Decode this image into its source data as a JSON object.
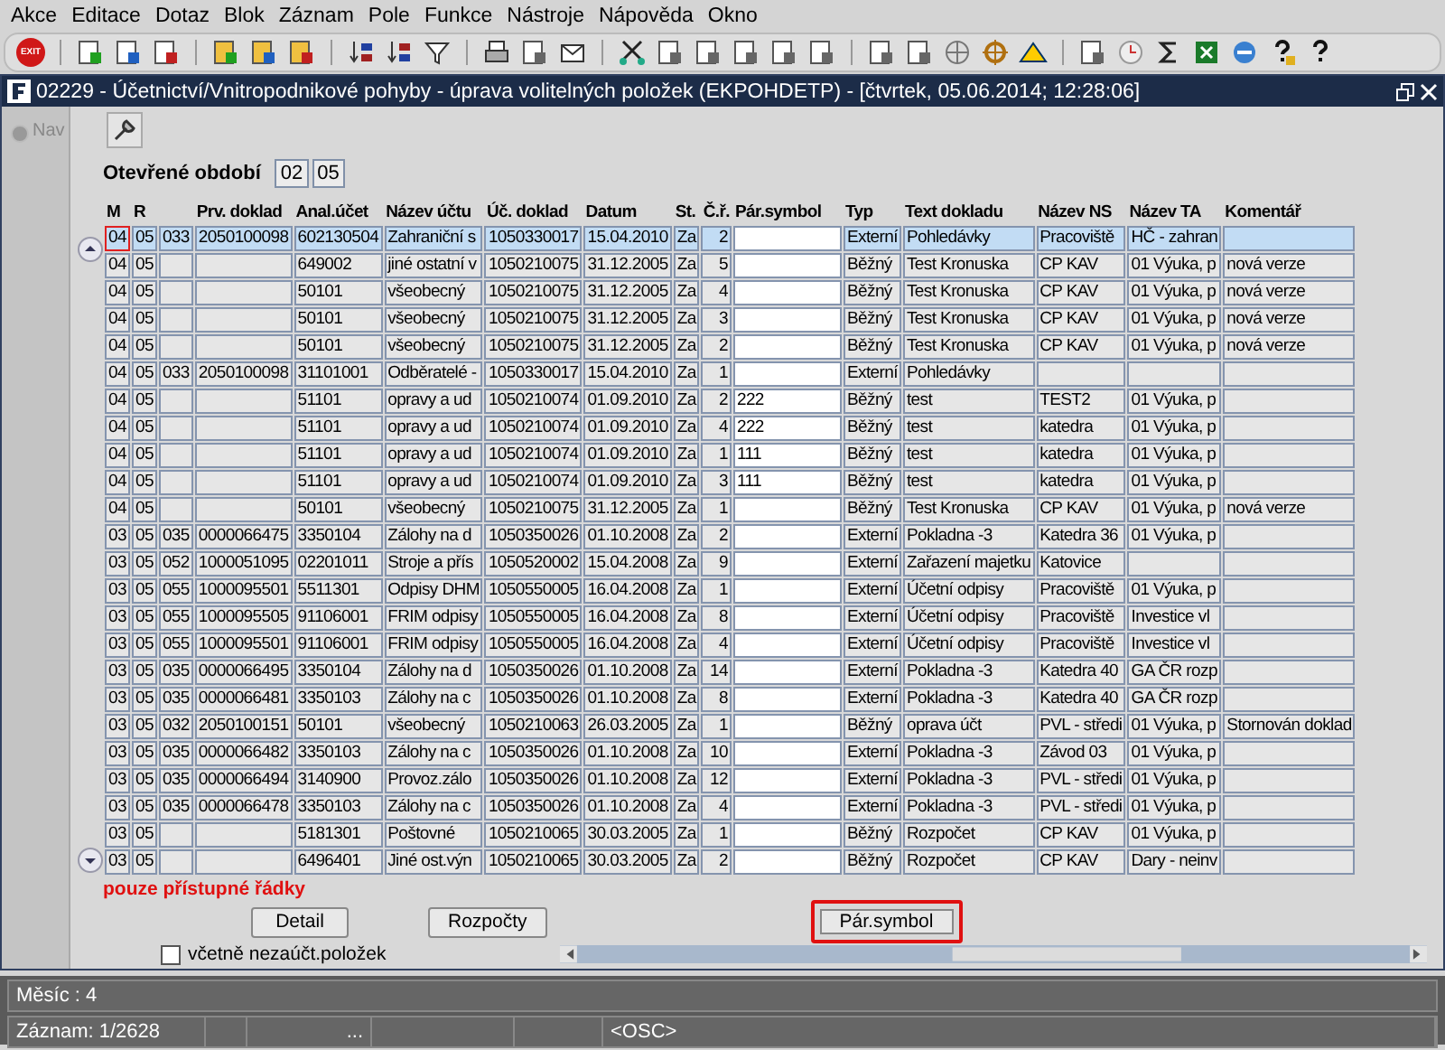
{
  "menu": [
    "Akce",
    "Editace",
    "Dotaz",
    "Blok",
    "Záznam",
    "Pole",
    "Funkce",
    "Nástroje",
    "Nápověda",
    "Okno"
  ],
  "toolbar": {
    "exit_label": "EXIT"
  },
  "window": {
    "title": "02229 - Účetnictví/Vnitropodnikové pohyby - úprava volitelných položek (EKPOHDETP) - [čtvrtek, 05.06.2014; 12:28:06]"
  },
  "nav": {
    "label": "Nav"
  },
  "period": {
    "label": "Otevřené období",
    "values": [
      "02",
      "05"
    ]
  },
  "table": {
    "columns": [
      {
        "label": "M",
        "kind": "text"
      },
      {
        "label": "R",
        "kind": "text"
      },
      {
        "kind": "text"
      },
      {
        "label": "Prv. doklad",
        "kind": "text"
      },
      {
        "label": "Anal.účet",
        "kind": "text"
      },
      {
        "label": "Název účtu",
        "kind": "text"
      },
      {
        "label": "Úč. doklad",
        "kind": "text"
      },
      {
        "label": "Datum",
        "kind": "text"
      },
      {
        "label": "St.",
        "kind": "text"
      },
      {
        "label": "Č.ř.",
        "kind": "number"
      },
      {
        "label": "Pár.symbol",
        "kind": "input"
      },
      {
        "label": "Typ",
        "kind": "text"
      },
      {
        "label": "Text dokladu",
        "kind": "text"
      },
      {
        "label": "Název NS",
        "kind": "text"
      },
      {
        "label": "Název TA",
        "kind": "text"
      },
      {
        "label": "Komentář",
        "kind": "text"
      }
    ],
    "rows": [
      {
        "selected": true,
        "focused": true,
        "cells": [
          "04",
          "05",
          "033",
          "2050100098",
          "602130504",
          "Zahraniční s",
          "1050330017",
          "15.04.2010",
          "Za",
          "2",
          null,
          "Externí",
          "Pohledávky",
          "Pracoviště",
          "HČ - zahran",
          null
        ]
      },
      {
        "selected": false,
        "focused": false,
        "cells": [
          "04",
          "05",
          null,
          null,
          "649002",
          "jiné ostatní v",
          "1050210075",
          "31.12.2005",
          "Za",
          "5",
          null,
          "Běžný",
          "Test Kronuska",
          "CP KAV",
          "01 Výuka, p",
          "nová verze"
        ]
      },
      {
        "selected": false,
        "focused": false,
        "cells": [
          "04",
          "05",
          null,
          null,
          "50101",
          "všeobecný",
          "1050210075",
          "31.12.2005",
          "Za",
          "4",
          null,
          "Běžný",
          "Test Kronuska",
          "CP KAV",
          "01 Výuka, p",
          "nová verze"
        ]
      },
      {
        "selected": false,
        "focused": false,
        "cells": [
          "04",
          "05",
          null,
          null,
          "50101",
          "všeobecný",
          "1050210075",
          "31.12.2005",
          "Za",
          "3",
          null,
          "Běžný",
          "Test Kronuska",
          "CP KAV",
          "01 Výuka, p",
          "nová verze"
        ]
      },
      {
        "selected": false,
        "focused": false,
        "cells": [
          "04",
          "05",
          null,
          null,
          "50101",
          "všeobecný",
          "1050210075",
          "31.12.2005",
          "Za",
          "2",
          null,
          "Běžný",
          "Test Kronuska",
          "CP KAV",
          "01 Výuka, p",
          "nová verze"
        ]
      },
      {
        "selected": false,
        "focused": false,
        "cells": [
          "04",
          "05",
          "033",
          "2050100098",
          "31101001",
          "Odběratelé -",
          "1050330017",
          "15.04.2010",
          "Za",
          "1",
          null,
          "Externí",
          "Pohledávky",
          null,
          null,
          null
        ]
      },
      {
        "selected": false,
        "focused": false,
        "cells": [
          "04",
          "05",
          null,
          null,
          "51101",
          "opravy a ud",
          "1050210074",
          "01.09.2010",
          "Za",
          "2",
          "222",
          "Běžný",
          "test",
          "TEST2",
          "01 Výuka, p",
          null
        ]
      },
      {
        "selected": false,
        "focused": false,
        "cells": [
          "04",
          "05",
          null,
          null,
          "51101",
          "opravy a ud",
          "1050210074",
          "01.09.2010",
          "Za",
          "4",
          "222",
          "Běžný",
          "test",
          "katedra",
          "01 Výuka, p",
          null
        ]
      },
      {
        "selected": false,
        "focused": false,
        "cells": [
          "04",
          "05",
          null,
          null,
          "51101",
          "opravy a ud",
          "1050210074",
          "01.09.2010",
          "Za",
          "1",
          "111",
          "Běžný",
          "test",
          "katedra",
          "01 Výuka, p",
          null
        ]
      },
      {
        "selected": false,
        "focused": false,
        "cells": [
          "04",
          "05",
          null,
          null,
          "51101",
          "opravy a ud",
          "1050210074",
          "01.09.2010",
          "Za",
          "3",
          "111",
          "Běžný",
          "test",
          "katedra",
          "01 Výuka, p",
          null
        ]
      },
      {
        "selected": false,
        "focused": false,
        "cells": [
          "04",
          "05",
          null,
          null,
          "50101",
          "všeobecný",
          "1050210075",
          "31.12.2005",
          "Za",
          "1",
          null,
          "Běžný",
          "Test Kronuska",
          "CP KAV",
          "01 Výuka, p",
          "nová verze"
        ]
      },
      {
        "selected": false,
        "focused": false,
        "cells": [
          "03",
          "05",
          "035",
          "0000066475",
          "3350104",
          "Zálohy na d",
          "1050350026",
          "01.10.2008",
          "Za",
          "2",
          null,
          "Externí",
          "Pokladna -3",
          "Katedra 36",
          "01 Výuka, p",
          null
        ]
      },
      {
        "selected": false,
        "focused": false,
        "cells": [
          "03",
          "05",
          "052",
          "1000051095",
          "02201011",
          "Stroje a přís",
          "1050520002",
          "15.04.2008",
          "Za",
          "9",
          null,
          "Externí",
          "Zařazení majetku",
          "Katovice",
          null,
          null
        ]
      },
      {
        "selected": false,
        "focused": false,
        "cells": [
          "03",
          "05",
          "055",
          "1000095501",
          "5511301",
          "Odpisy DHM",
          "1050550005",
          "16.04.2008",
          "Za",
          "1",
          null,
          "Externí",
          "Účetní odpisy",
          "Pracoviště",
          "01 Výuka, p",
          null
        ]
      },
      {
        "selected": false,
        "focused": false,
        "cells": [
          "03",
          "05",
          "055",
          "1000095505",
          "91106001",
          "FRIM odpisy",
          "1050550005",
          "16.04.2008",
          "Za",
          "8",
          null,
          "Externí",
          "Účetní odpisy",
          "Pracoviště",
          "Investice vl",
          null
        ]
      },
      {
        "selected": false,
        "focused": false,
        "cells": [
          "03",
          "05",
          "055",
          "1000095501",
          "91106001",
          "FRIM odpisy",
          "1050550005",
          "16.04.2008",
          "Za",
          "4",
          null,
          "Externí",
          "Účetní odpisy",
          "Pracoviště",
          "Investice vl",
          null
        ]
      },
      {
        "selected": false,
        "focused": false,
        "cells": [
          "03",
          "05",
          "035",
          "0000066495",
          "3350104",
          "Zálohy na d",
          "1050350026",
          "01.10.2008",
          "Za",
          "14",
          null,
          "Externí",
          "Pokladna -3",
          "Katedra 40",
          "GA ČR rozp",
          null
        ]
      },
      {
        "selected": false,
        "focused": false,
        "cells": [
          "03",
          "05",
          "035",
          "0000066481",
          "3350103",
          "Zálohy na c",
          "1050350026",
          "01.10.2008",
          "Za",
          "8",
          null,
          "Externí",
          "Pokladna -3",
          "Katedra 40",
          "GA ČR rozp",
          null
        ]
      },
      {
        "selected": false,
        "focused": false,
        "cells": [
          "03",
          "05",
          "032",
          "2050100151",
          "50101",
          "všeobecný",
          "1050210063",
          "26.03.2005",
          "Za",
          "1",
          null,
          "Běžný",
          "oprava účt",
          "PVL - středi",
          "01 Výuka, p",
          "Stornován doklad"
        ]
      },
      {
        "selected": false,
        "focused": false,
        "cells": [
          "03",
          "05",
          "035",
          "0000066482",
          "3350103",
          "Zálohy na c",
          "1050350026",
          "01.10.2008",
          "Za",
          "10",
          null,
          "Externí",
          "Pokladna -3",
          "Závod 03",
          "01 Výuka, p",
          null
        ]
      },
      {
        "selected": false,
        "focused": false,
        "cells": [
          "03",
          "05",
          "035",
          "0000066494",
          "3140900",
          "Provoz.zálo",
          "1050350026",
          "01.10.2008",
          "Za",
          "12",
          null,
          "Externí",
          "Pokladna -3",
          "PVL - středi",
          "01 Výuka, p",
          null
        ]
      },
      {
        "selected": false,
        "focused": false,
        "cells": [
          "03",
          "05",
          "035",
          "0000066478",
          "3350103",
          "Zálohy na c",
          "1050350026",
          "01.10.2008",
          "Za",
          "4",
          null,
          "Externí",
          "Pokladna -3",
          "PVL - středi",
          "01 Výuka, p",
          null
        ]
      },
      {
        "selected": false,
        "focused": false,
        "cells": [
          "03",
          "05",
          null,
          null,
          "5181301",
          "Poštovné",
          "1050210065",
          "30.03.2005",
          "Za",
          "1",
          null,
          "Běžný",
          "Rozpočet",
          "CP KAV",
          "01 Výuka, p",
          null
        ]
      },
      {
        "selected": false,
        "focused": false,
        "cells": [
          "03",
          "05",
          null,
          null,
          "6496401",
          "Jiné ost.výn",
          "1050210065",
          "30.03.2005",
          "Za",
          "2",
          null,
          "Běžný",
          "Rozpočet",
          "CP KAV",
          "Dary - neinv",
          null
        ]
      }
    ]
  },
  "notice": "pouze přístupné řádky",
  "buttons": [
    {
      "label": "Detail",
      "highlighted": false
    },
    {
      "label": "Rozpočty",
      "highlighted": false
    },
    {
      "label": "Pár.symbol",
      "highlighted": true
    }
  ],
  "checkbox": {
    "label": "včetně nezaúčt.položek",
    "checked": false
  },
  "status_bar": {
    "message": "Měsíc : 4",
    "record": "Záznam: 1/2628",
    "field_3": "...",
    "mode": "<OSC>"
  }
}
